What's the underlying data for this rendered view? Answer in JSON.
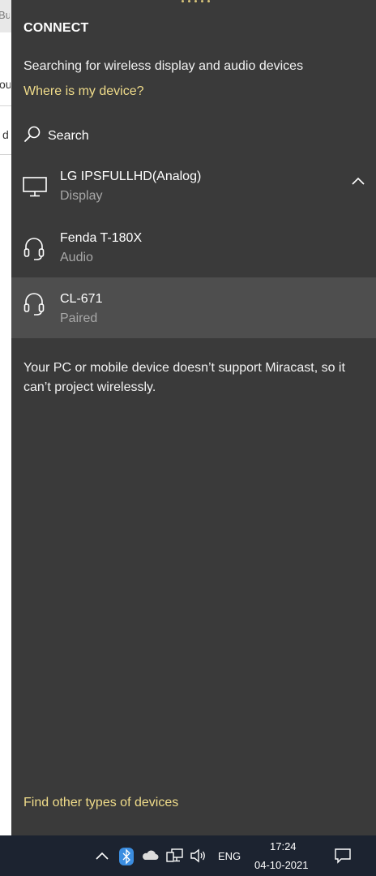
{
  "background_app": {
    "fragments": [
      "Bus",
      "ou",
      "d"
    ]
  },
  "panel": {
    "title": "CONNECT",
    "status_text": "Searching for wireless display and audio devices",
    "help_link": "Where is my device?",
    "search_label": "Search",
    "devices": [
      {
        "name": "LG IPSFULLHD(Analog)",
        "type": "Display",
        "icon": "monitor-icon",
        "expanded": true
      },
      {
        "name": "Fenda T-180X",
        "type": "Audio",
        "icon": "headset-icon"
      },
      {
        "name": "CL-671",
        "type": "Paired",
        "icon": "headset-icon",
        "selected": true
      }
    ],
    "miracast_message": "Your PC or mobile device doesn’t support Miracast, so it can’t project wirelessly.",
    "find_other_link": "Find other types of devices"
  },
  "taskbar": {
    "language": "ENG",
    "time": "17:24",
    "date": "04-10-2021",
    "tray_icons": [
      "chevron-up-icon",
      "bluetooth-icon",
      "onedrive-cloud-icon",
      "network-icon",
      "volume-icon",
      "action-center-icon"
    ]
  },
  "colors": {
    "panel_bg": "#3a3a3a",
    "selected_bg": "#4e4e4e",
    "accent_link": "#f0dc8a",
    "secondary_text": "#a8a8a8",
    "taskbar_bg": "#1c2330",
    "bluetooth_blue": "#3b8de0"
  }
}
